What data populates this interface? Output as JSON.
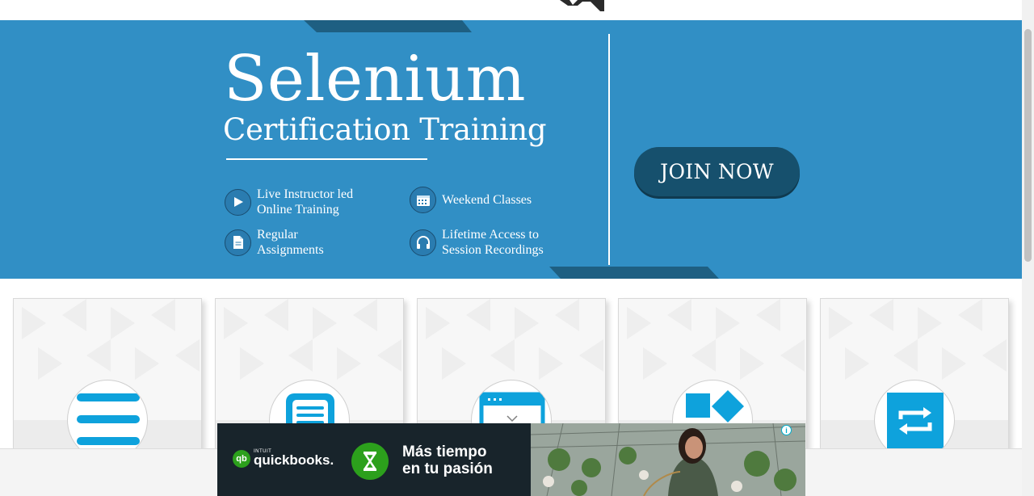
{
  "banner": {
    "title": "Selenium",
    "subtitle": "Certification Training",
    "features": [
      {
        "icon": "play-icon",
        "lines": [
          "Live Instructor led",
          "Online Training"
        ]
      },
      {
        "icon": "calendar-icon",
        "lines": [
          "Weekend Classes"
        ]
      },
      {
        "icon": "document-icon",
        "lines": [
          "Regular",
          "Assignments"
        ]
      },
      {
        "icon": "headphones-icon",
        "lines": [
          "Lifetime Access to",
          "Session Recordings"
        ]
      }
    ],
    "cta_label": "JOIN NOW"
  },
  "cards": [
    {
      "icon": "menu-icon"
    },
    {
      "icon": "chat-document-icon"
    },
    {
      "icon": "browser-window-icon"
    },
    {
      "icon": "shapes-icon"
    },
    {
      "icon": "repeat-icon"
    }
  ],
  "ad": {
    "brand_small": "INTUIT",
    "brand": "quickbooks.",
    "headline": [
      "Más tiempo",
      "en tu pasión"
    ],
    "info": "i"
  },
  "colors": {
    "banner_blue": "#318fc5",
    "banner_dark": "#16506d",
    "card_icon_blue": "#0ea2dc",
    "quickbooks_green": "#2ca01c",
    "ad_dark": "#18242b"
  }
}
